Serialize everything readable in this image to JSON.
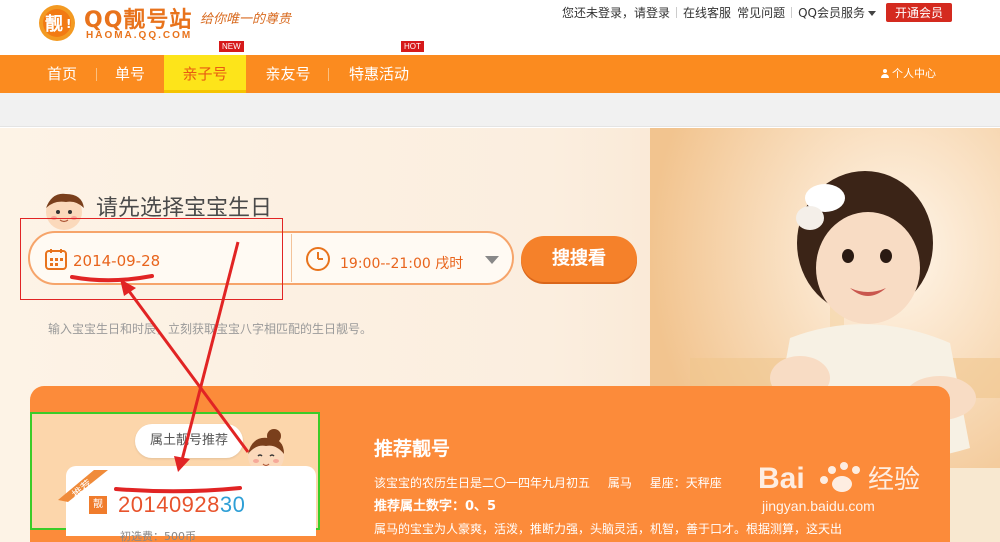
{
  "header": {
    "logo_title": "QQ靓号站",
    "logo_domain": "HAOMA.QQ.COM",
    "slogan": "给你唯一的尊贵",
    "login_prompt": "您还未登录，请登录",
    "customer_service": "在线客服",
    "faq": "常见问题",
    "vip_service": "QQ会员服务",
    "open_vip": "开通会员"
  },
  "nav": {
    "items": [
      {
        "label": "首页"
      },
      {
        "label": "单号"
      },
      {
        "label": "亲子号",
        "badge": "NEW"
      },
      {
        "label": "亲友号"
      },
      {
        "label": "特惠活动",
        "badge": "HOT"
      }
    ],
    "personal_center": "个人中心"
  },
  "hero": {
    "title": "请先选择宝宝生日",
    "date_value": "2014-09-28",
    "time_value": "19:00--21:00 戌时",
    "search_button": "搜搜看",
    "hint": "输入宝宝生日和时辰，立刻获取宝宝八字相匹配的生日靓号。"
  },
  "recommend_card": {
    "speech": "属土靓号推荐",
    "ribbon": "推荐",
    "liang_badge": "靓",
    "number_main": "20140928",
    "number_tail": "30",
    "fee": "初选费：500币"
  },
  "recommend_info": {
    "title": "推荐靓号",
    "lunar_birthday": "该宝宝的农历生日是二〇一四年九月初五",
    "zodiac": "属马",
    "constellation": "星座：天秤座",
    "lucky_digits": "推荐属土数字：0、5",
    "description": "属马的宝宝为人豪爽，活泼，推断力强，头脑灵活，机智，善于口才。根据测算，这天出"
  },
  "watermark": {
    "brand": "Bai",
    "brand_cn": "经验",
    "url": "jingyan.baidu.com"
  },
  "colors": {
    "nav_orange": "#fb8b1f",
    "active_yellow": "#fde41a",
    "accent_orange": "#f5812a",
    "annotation_red": "#e12424",
    "annotation_green": "#3bcc28"
  }
}
